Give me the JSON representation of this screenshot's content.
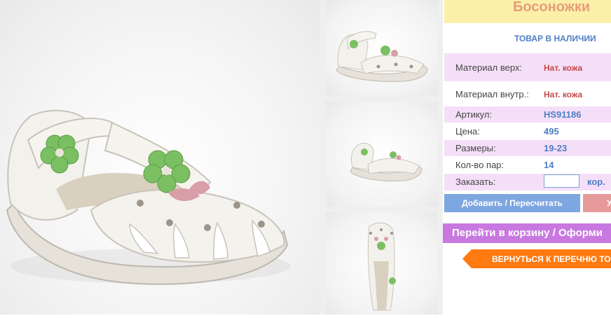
{
  "product": {
    "title": "Босоножки",
    "stock_status": "ТОВАР В НАЛИЧИИ"
  },
  "details": {
    "material_outer_label": "Материал верх:",
    "material_outer_value": "Нат. кожа",
    "material_inner_label": "Материал внутр.:",
    "material_inner_value": "Нат. кожа",
    "article_label": "Артикул:",
    "article_value": "HS91186",
    "price_label": "Цена:",
    "price_value": "495",
    "sizes_label": "Размеры:",
    "sizes_value": "19-23",
    "pairs_label": "Кол-во пар:",
    "pairs_value": "14"
  },
  "order": {
    "label": "Заказать:",
    "quantity_value": "",
    "unit": "кор."
  },
  "buttons": {
    "add_recalc": "Добавить / Пересчитать",
    "delete_partial": "У",
    "go_to_cart": "Перейти в корзину / Оформи",
    "back_to_list": "ВЕРНУТЬСЯ К ПЕРЕЧНЮ ТОВА"
  },
  "colors": {
    "title_bg": "#fbf0a8",
    "title_text": "#e89c7c",
    "row_pink": "#f5dff8",
    "value_blue": "#4f7fc4",
    "value_red": "#c44a4a",
    "add_button": "#7ea6e0",
    "cart_button": "#c978e0",
    "back_button": "#ff7a10"
  },
  "icons": {
    "back_arrow": "arrow-left-icon"
  }
}
